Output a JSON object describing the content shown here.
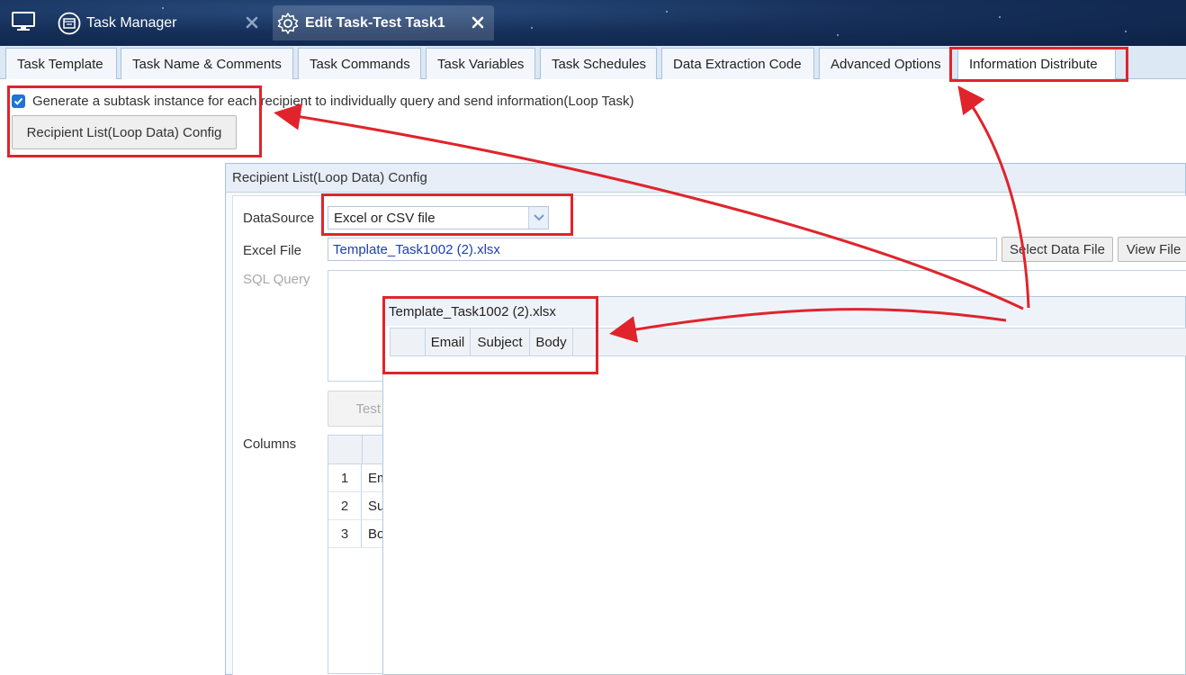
{
  "titlebar": {
    "tabs": [
      {
        "label": "Task Manager"
      },
      {
        "label": "Edit Task-Test Task1"
      }
    ]
  },
  "tabs": [
    "Task Template",
    "Task Name & Comments",
    "Task Commands",
    "Task Variables",
    "Task Schedules",
    "Data Extraction Code",
    "Advanced Options",
    "Information Distribute"
  ],
  "content": {
    "loop_checkbox_checked": true,
    "loop_checkbox_label": "Generate a subtask instance for each recipient to individually query and send information(Loop Task)",
    "config_button_label": "Recipient List(Loop Data) Config"
  },
  "dialog": {
    "title": "Recipient List(Loop Data) Config",
    "datasource_label": "DataSource",
    "datasource_value": "Excel or CSV file",
    "excel_file_label": "Excel File",
    "excel_file_value": "Template_Task1002 (2).xlsx",
    "select_file_button": "Select Data File",
    "view_file_button": "View File",
    "sql_query_label": "SQL Query",
    "test_button": "Test",
    "columns_label": "Columns",
    "columns": [
      {
        "num": "1",
        "name": "Em"
      },
      {
        "num": "2",
        "name": "Su"
      },
      {
        "num": "3",
        "name": "Bo"
      }
    ]
  },
  "preview": {
    "title": "Template_Task1002 (2).xlsx",
    "headers": [
      "Email",
      "Subject",
      "Body"
    ]
  },
  "colors": {
    "accent_red": "#e0242b",
    "titlebar_bg": "#16305a",
    "checkbox_blue": "#1e73d6",
    "link_blue": "#1c3fb0"
  }
}
